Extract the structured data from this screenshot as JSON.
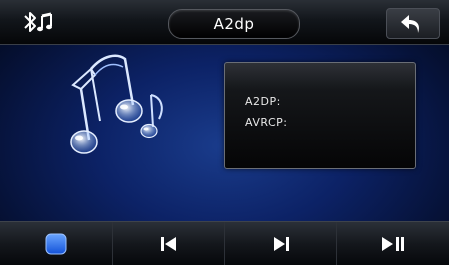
{
  "header": {
    "title": "A2dp",
    "bluetooth_icon": "bluetooth-music-icon",
    "back_icon": "back-arrow-icon"
  },
  "art": {
    "icon": "music-notes-icon"
  },
  "info": {
    "a2dp_label": "A2DP:",
    "avrcp_label": "AVRCP:"
  },
  "controls": [
    {
      "name": "stop",
      "icon": "stop-icon",
      "accent": "#1e6bff"
    },
    {
      "name": "previous",
      "icon": "previous-track-icon"
    },
    {
      "name": "next",
      "icon": "next-track-icon"
    },
    {
      "name": "play-pause",
      "icon": "play-pause-icon"
    }
  ],
  "colors": {
    "background": "#0c2266",
    "accent": "#1e6bff"
  }
}
